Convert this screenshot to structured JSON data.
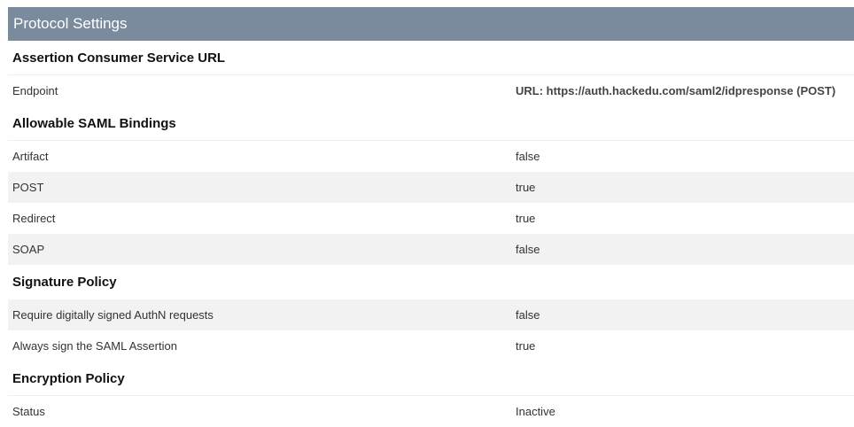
{
  "panel": {
    "title": "Protocol Settings"
  },
  "sections": {
    "acs": {
      "heading": "Assertion Consumer Service URL",
      "endpoint_label": "Endpoint",
      "endpoint_value": "URL: https://auth.hackedu.com/saml2/idpresponse (POST)"
    },
    "bindings": {
      "heading": "Allowable SAML Bindings",
      "rows": [
        {
          "label": "Artifact",
          "value": "false"
        },
        {
          "label": "POST",
          "value": "true"
        },
        {
          "label": "Redirect",
          "value": "true"
        },
        {
          "label": "SOAP",
          "value": "false"
        }
      ]
    },
    "signature": {
      "heading": "Signature Policy",
      "rows": [
        {
          "label": "Require digitally signed AuthN requests",
          "value": "false"
        },
        {
          "label": "Always sign the SAML Assertion",
          "value": "true"
        }
      ]
    },
    "encryption": {
      "heading": "Encryption Policy",
      "status_label": "Status",
      "status_value": "Inactive"
    }
  }
}
